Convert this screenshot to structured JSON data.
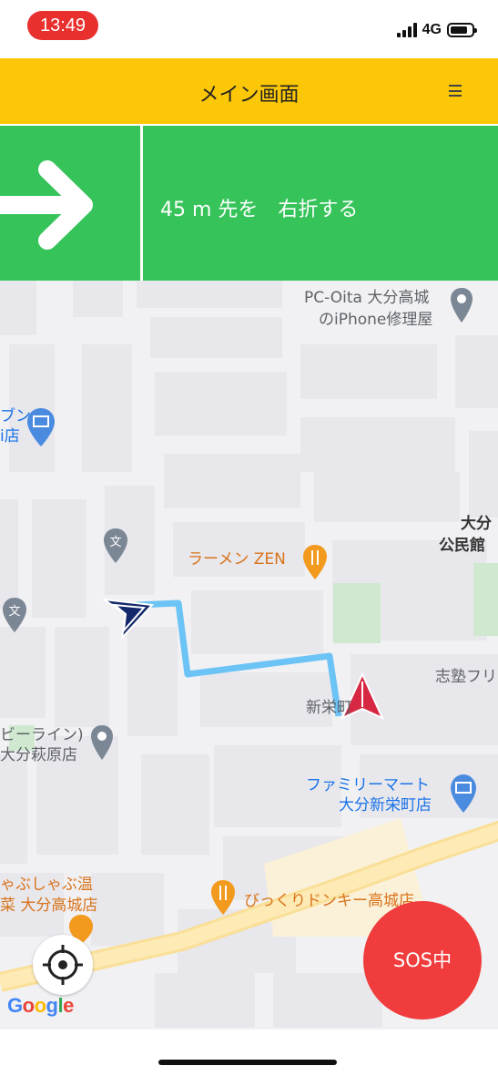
{
  "status_bar": {
    "time": "13:49",
    "network": "4G",
    "signal_bars": 4,
    "battery_level": 0.8
  },
  "header": {
    "title": "メイン画面",
    "menu_icon": "hamburger-menu-icon",
    "background_color": "#fcc707"
  },
  "navigation": {
    "direction_icon": "right-arrow-icon",
    "instruction": "45 m 先を　右折する",
    "background_color": "#36c45a"
  },
  "map": {
    "labels": {
      "pc_oita_line1": "PC-Oita 大分高城",
      "pc_oita_line2": "のiPhone修理屋",
      "left_store_line1": "ブン",
      "left_store_line2": "i店",
      "ramen": "ラーメン ZEN",
      "oita_line1": "大分",
      "oita_line2": "公民館",
      "shijuku": "志塾フリ",
      "shinsakae": "新栄町",
      "line_store_line1": "ビーライン)",
      "line_store_line2": "大分萩原店",
      "familymart_line1": "ファミリーマート",
      "familymart_line2": "大分新栄町店",
      "shabu_line1": "ゃぶしゃぶ温",
      "shabu_line2": "菜 大分高城店",
      "bikkuri": "びっくりドンキー高城店"
    },
    "school_glyph": "文",
    "route_color": "#6cc3f5",
    "current_location_icon": "navigation-arrow-icon",
    "destination_icon": "destination-marker-icon",
    "locate_icon": "crosshair-icon",
    "attribution": [
      "G",
      "o",
      "o",
      "g",
      "l",
      "e"
    ]
  },
  "sos_button": {
    "label": "SOS中",
    "color": "#f03c3c"
  }
}
